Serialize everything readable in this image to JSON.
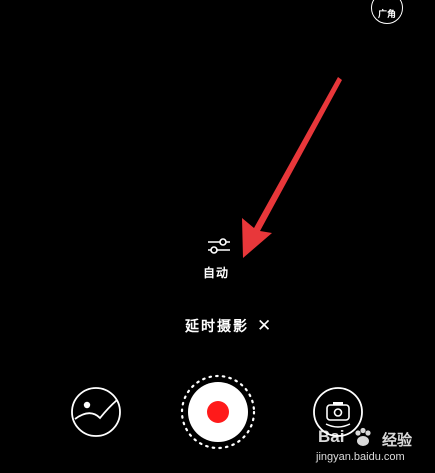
{
  "top_bar": {
    "wide_angle_label": "广角"
  },
  "settings": {
    "auto_label": "自动"
  },
  "mode": {
    "label": "延时摄影",
    "close_symbol": "✕"
  },
  "watermark": {
    "brand": "Bai",
    "brand_suffix": "经验",
    "url": "jingyan.baidu.com"
  },
  "colors": {
    "arrow": "#e8373a",
    "shutter_record": "#ff1a1a",
    "background": "#000000"
  },
  "icons": {
    "wide_angle": "wide-angle-toggle",
    "settings": "sliders-icon",
    "gallery": "gallery-thumbnail",
    "shutter": "record-shutter",
    "flip": "camera-switch-icon"
  }
}
